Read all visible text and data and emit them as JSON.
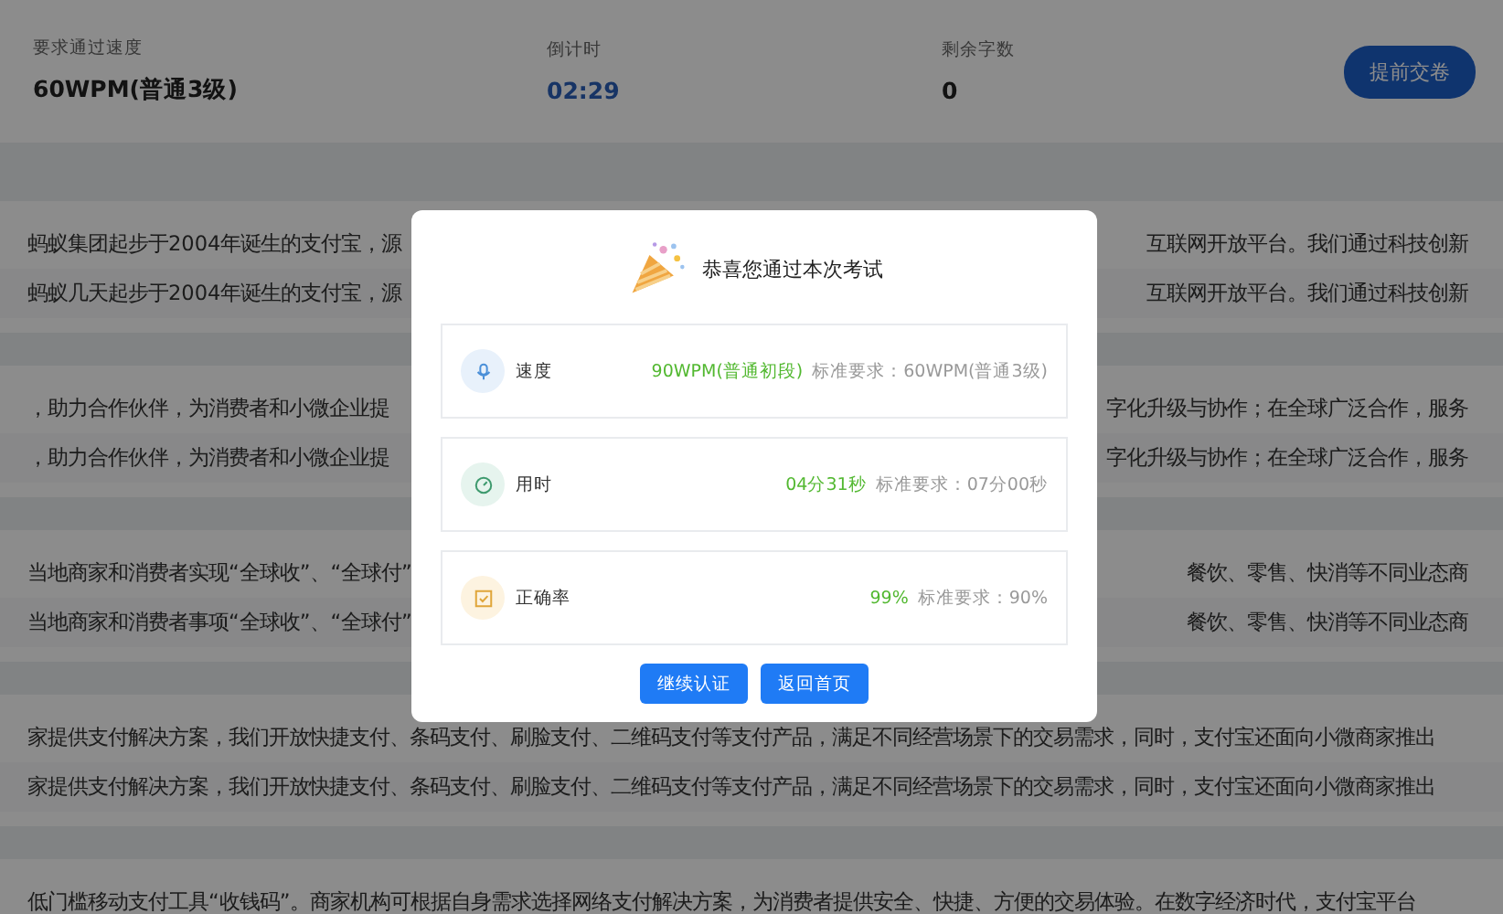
{
  "header": {
    "fields": [
      {
        "label": "要求通过速度",
        "value": "60WPM(普通3级)",
        "kind": "plain"
      },
      {
        "label": "倒计时",
        "value": "02:29",
        "kind": "timer"
      },
      {
        "label": "剩余字数",
        "value": "0",
        "kind": "plain"
      }
    ],
    "submit_button": "提前交卷"
  },
  "paragraphs": [
    {
      "lines": [
        {
          "left": "蚂蚁集团起步于2004年诞生的支付宝，源",
          "right": "互联网开放平台。我们通过科技创新"
        },
        {
          "left": "蚂蚁几天起步于2004年诞生的支付宝，源",
          "right": "互联网开放平台。我们通过科技创新"
        }
      ]
    },
    {
      "lines": [
        {
          "left": "，助力合作伙伴，为消费者和小微企业提",
          "right": "字化升级与协作；在全球广泛合作，服务"
        },
        {
          "left": "，助力合作伙伴，为消费者和小微企业提",
          "right": "字化升级与协作；在全球广泛合作，服务"
        }
      ]
    },
    {
      "lines": [
        {
          "left": "当地商家和消费者实现“全球收”、“全球付”",
          "right": "餐饮、零售、快消等不同业态商"
        },
        {
          "left": "当地商家和消费者事项“全球收”、“全球付”",
          "right": "餐饮、零售、快消等不同业态商"
        }
      ]
    },
    {
      "lines": [
        {
          "left": "家提供支付解决方案，我们开放快捷支付、条码支付、刷脸支付、二维码支付等支付产品，满足不同经营场景下的交易需求，同时，支付宝还面向小微商家推出"
        },
        {
          "left": "家提供支付解决方案，我们开放快捷支付、条码支付、刷脸支付、二维码支付等支付产品，满足不同经营场景下的交易需求，同时，支付宝还面向小微商家推出"
        }
      ]
    },
    {
      "lines": [
        {
          "left": "低门槛移动支付工具“收钱码”。商家机构可根据自身需求选择网络支付解决方案，为消费者提供安全、快捷、方便的交易体验。在数字经济时代，支付宝平台"
        }
      ]
    }
  ],
  "dialog": {
    "title": "恭喜您通过本次考试",
    "results": [
      {
        "kind": "speed",
        "label": "速度",
        "value": "90WPM(普通初段)",
        "requirement": "标准要求：60WPM(普通3级)"
      },
      {
        "kind": "time",
        "label": "用时",
        "value": "04分31秒",
        "requirement": "标准要求：07分00秒"
      },
      {
        "kind": "accuracy",
        "label": "正确率",
        "value": "99%",
        "requirement": "标准要求：90%"
      }
    ],
    "buttons": [
      "继续认证",
      "返回首页"
    ]
  }
}
